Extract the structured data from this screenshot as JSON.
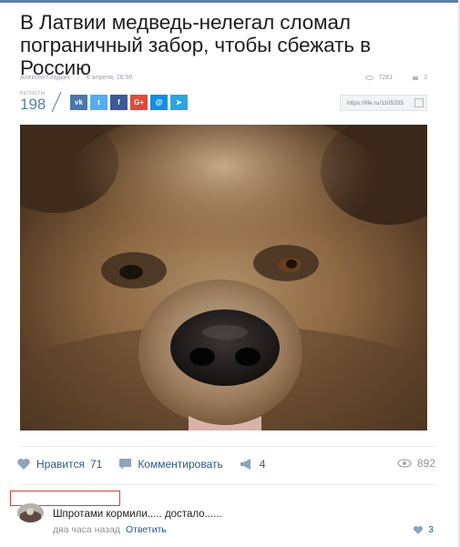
{
  "article": {
    "title": "В Латвии медведь-нелегал сломал пограничный забор, чтобы сбежать в Россию",
    "author": "Алексей Гладких",
    "date": "6 апреля, 16:50",
    "views": "7281",
    "comments": "3"
  },
  "reposts": {
    "label": "РЕПОСТЫ",
    "count": "198"
  },
  "share_buttons": [
    {
      "icon": "vk-icon",
      "glyph": "vk",
      "color": "#4a76a8"
    },
    {
      "icon": "twitter-icon",
      "glyph": "t",
      "color": "#55acee"
    },
    {
      "icon": "facebook-icon",
      "glyph": "f",
      "color": "#3b5998"
    },
    {
      "icon": "google-plus-icon",
      "glyph": "G+",
      "color": "#dd4b39"
    },
    {
      "icon": "mail-icon",
      "glyph": "@",
      "color": "#168de2"
    },
    {
      "icon": "telegram-icon",
      "glyph": "➤",
      "color": "#2ca5e0"
    }
  ],
  "short_url": "https://life.ru/1105335",
  "post_actions": {
    "like_label": "Нравится",
    "like_count": "71",
    "comment_label": "Комментировать",
    "share_count": "4",
    "views": "892"
  },
  "comment": {
    "text": "Шпротами кормили..... достало......",
    "time": "два часа назад",
    "reply_label": "Ответить",
    "likes": "3"
  },
  "colors": {
    "accent": "#2a5885",
    "highlight": "#e53935"
  }
}
